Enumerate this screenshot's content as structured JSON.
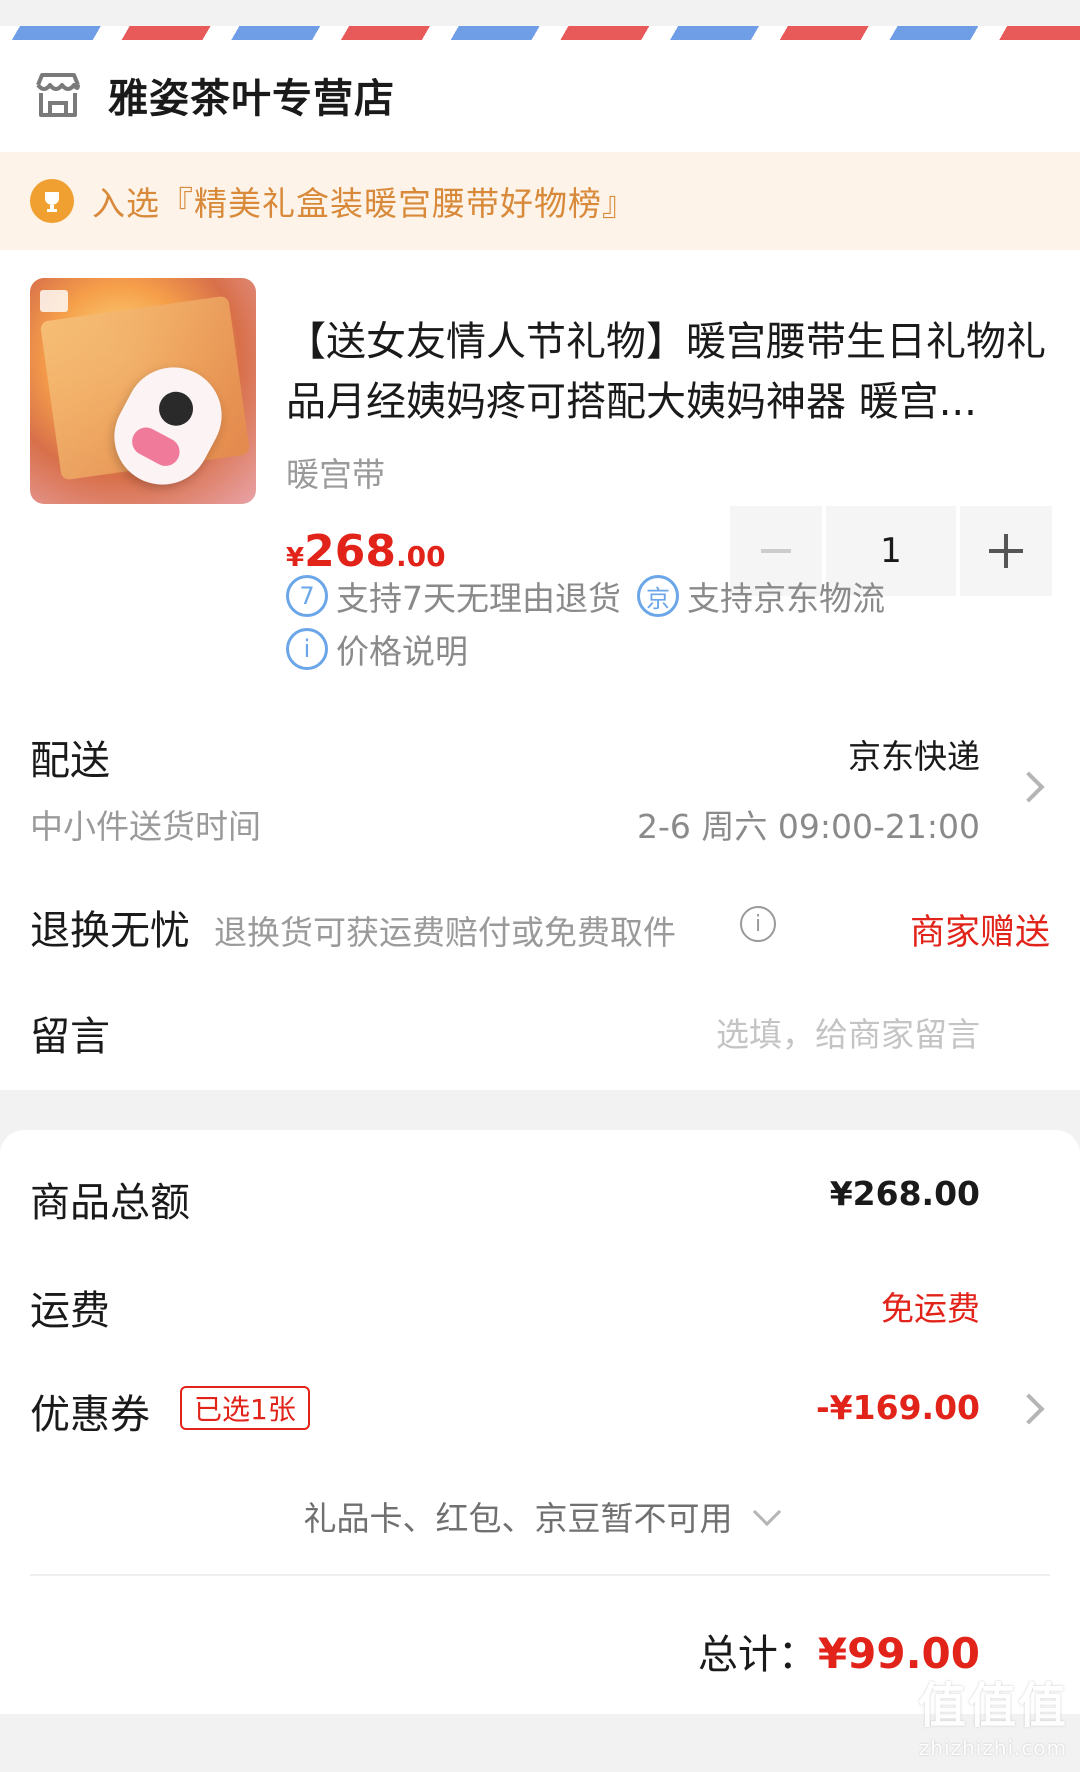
{
  "shop": {
    "name": "雅姿茶叶专营店",
    "icon": "store-icon"
  },
  "ranking": {
    "text": "入选『精美礼盒装暖宫腰带好物榜』",
    "icon": "trophy-icon",
    "color": "#d88a3a"
  },
  "product": {
    "title": "【送女友情人节礼物】暖宫腰带生日礼物礼品月经姨妈疼可搭配大姨妈神器 暖宫...",
    "variant": "暖宫带",
    "price": {
      "currency": "¥",
      "integer": "268",
      "decimal": ".00"
    },
    "quantity": "1",
    "services": [
      {
        "icon_text": "7",
        "icon": "seven-day-icon",
        "label": "支持7天无理由退货"
      },
      {
        "icon_text": "京",
        "icon": "jd-logistics-icon",
        "label": "支持京东物流"
      },
      {
        "icon_text": "i",
        "icon": "info-icon",
        "label": "价格说明"
      }
    ]
  },
  "delivery": {
    "label": "配送",
    "carrier": "京东快递",
    "sub_label": "中小件送货时间",
    "time": "2-6 周六 09:00-21:00"
  },
  "returns": {
    "label": "退换无忧",
    "desc": "退换货可获运费赔付或免费取件",
    "value": "商家赠送"
  },
  "message": {
    "label": "留言",
    "placeholder": "选填，给商家留言"
  },
  "summary": {
    "goods_total_label": "商品总额",
    "goods_total": "¥268.00",
    "shipping_label": "运费",
    "shipping": "免运费",
    "coupon_label": "优惠券",
    "coupon_badge": "已选1张",
    "coupon_value": "-¥169.00",
    "unavailable": "礼品卡、红包、京豆暂不可用",
    "total_label": "总计：",
    "total": "¥99.00"
  },
  "watermark": {
    "line1": "值值值",
    "line2": "zhizhizhi.com"
  },
  "colors": {
    "accent_red": "#e2231a",
    "service_blue": "#6aa6e8",
    "rank_orange": "#d88a3a"
  }
}
